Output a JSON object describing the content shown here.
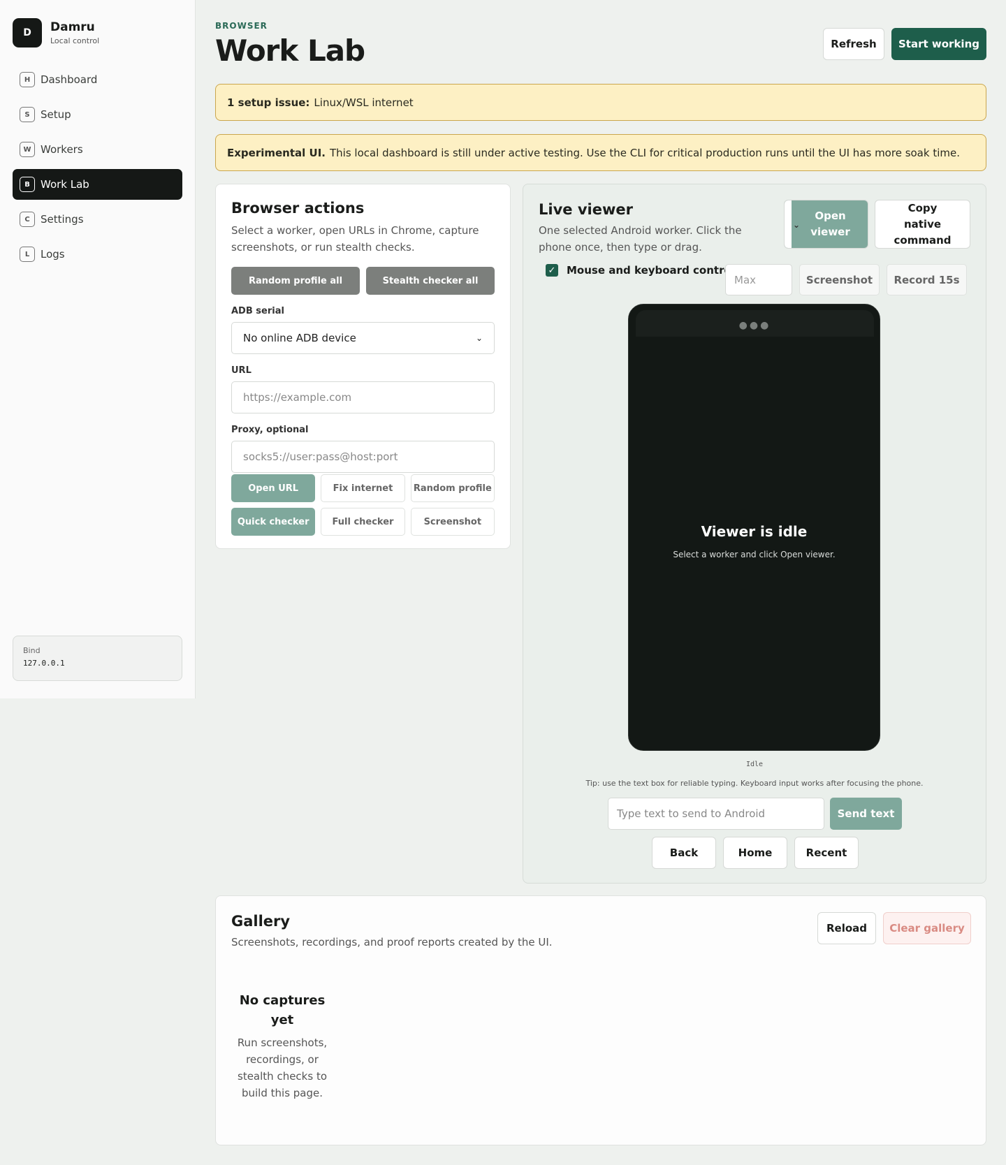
{
  "sidebar": {
    "logo_letter": "D",
    "brand_name": "Damru",
    "brand_sub": "Local control",
    "items": [
      {
        "key": "H",
        "label": "Dashboard",
        "active": false
      },
      {
        "key": "S",
        "label": "Setup",
        "active": false
      },
      {
        "key": "W",
        "label": "Workers",
        "active": false
      },
      {
        "key": "B",
        "label": "Work Lab",
        "active": true
      },
      {
        "key": "C",
        "label": "Settings",
        "active": false
      },
      {
        "key": "L",
        "label": "Logs",
        "active": false
      }
    ],
    "bind_label": "Bind",
    "bind_value": "127.0.0.1"
  },
  "header": {
    "eyebrow": "BROWSER",
    "title": "Work Lab",
    "refresh": "Refresh",
    "start": "Start working"
  },
  "banners": {
    "setup_bold": "1 setup issue:",
    "setup_text": "Linux/WSL internet",
    "exp_bold": "Experimental UI.",
    "exp_text": "This local dashboard is still under active testing. Use the CLI for critical production runs until the UI has more soak time."
  },
  "browser": {
    "title": "Browser actions",
    "desc": "Select a worker, open URLs in Chrome, capture screenshots, or run stealth checks.",
    "random_all": "Random profile all",
    "stealth_all": "Stealth checker all",
    "adb_label": "ADB serial",
    "adb_value": "No online ADB device",
    "url_label": "URL",
    "url_placeholder": "https://example.com",
    "proxy_label": "Proxy, optional",
    "proxy_placeholder": "socks5://user:pass@host:port",
    "open_url": "Open URL",
    "fix_internet": "Fix internet",
    "random_profile": "Random profile",
    "quick_checker": "Quick checker",
    "full_checker": "Full checker",
    "screenshot": "Screenshot"
  },
  "viewer": {
    "title": "Live viewer",
    "desc": "One selected Android worker. Click the phone once, then type or drag.",
    "open_viewer": "Open viewer",
    "copy_native": "Copy native command",
    "control_label": "Mouse and keyboard control",
    "control_checked": true,
    "max_placeholder": "Max",
    "screenshot": "Screenshot",
    "record": "Record 15s",
    "idle_title": "Viewer is idle",
    "idle_sub": "Select a worker and click Open viewer.",
    "status": "Idle",
    "tip": "Tip: use the text box for reliable typing. Keyboard input works after focusing the phone.",
    "type_placeholder": "Type text to send to Android",
    "send_text": "Send text",
    "back": "Back",
    "home": "Home",
    "recent": "Recent"
  },
  "gallery": {
    "title": "Gallery",
    "desc": "Screenshots, recordings, and proof reports created by the UI.",
    "reload": "Reload",
    "clear": "Clear gallery",
    "empty_title": "No captures yet",
    "empty_sub": "Run screenshots, recordings, or stealth checks to build this page."
  },
  "colors": {
    "accent": "#1e5e4b",
    "teal": "#7fa89c",
    "warning_bg": "#fdf0c4"
  }
}
